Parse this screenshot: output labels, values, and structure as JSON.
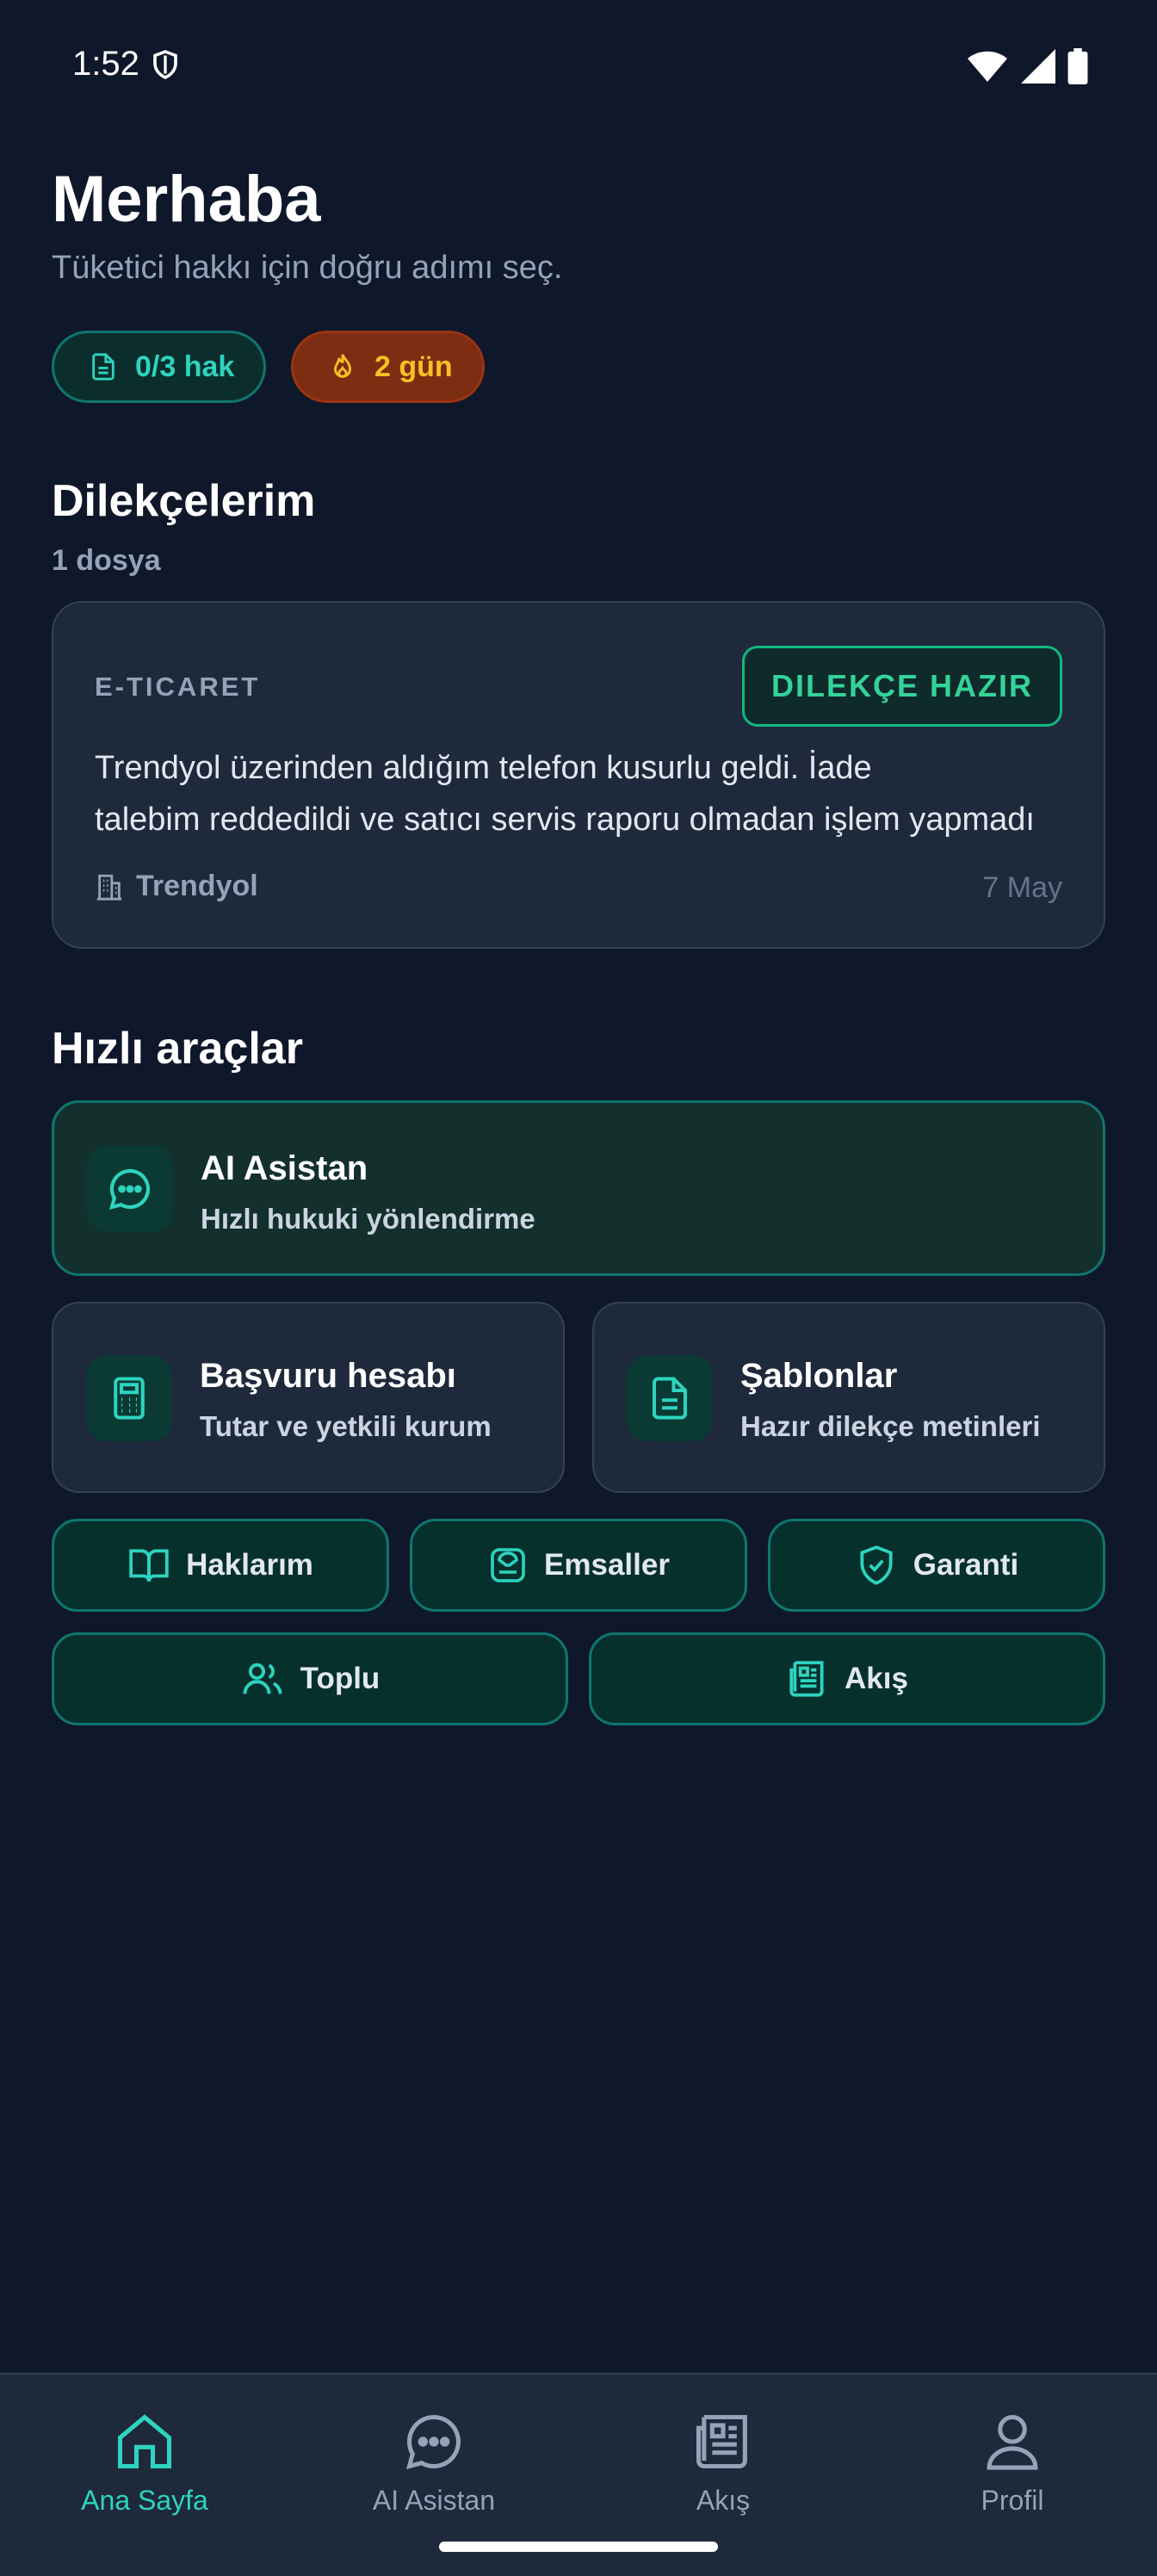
{
  "status_bar": {
    "time": "1:52"
  },
  "header": {
    "title": "Merhaba",
    "subtitle": "Tüketici hakkı için doğru adımı seç."
  },
  "chips": {
    "quota": "0/3 hak",
    "streak": "2 gün"
  },
  "petitions": {
    "title": "Dilekçelerim",
    "count": "1 dosya",
    "items": [
      {
        "category": "E-TICARET",
        "status": "DILEKÇE HAZIR",
        "description_line1": "Trendyol üzerinden aldığım telefon kusurlu geldi. İade",
        "description_line2": "talebim reddedildi ve satıcı servis raporu olmadan işlem yapmadı",
        "company": "Trendyol",
        "date": "7 May"
      }
    ]
  },
  "quick_tools": {
    "title": "Hızlı araçlar",
    "ai": {
      "title": "AI Asistan",
      "subtitle": "Hızlı hukuki yönlendirme"
    },
    "calc": {
      "title": "Başvuru hesabı",
      "subtitle": "Tutar ve yetkili kurum"
    },
    "templates": {
      "title": "Şablonlar",
      "subtitle": "Hazır dilekçe metinleri"
    },
    "pills": {
      "rights": "Haklarım",
      "precedents": "Emsaller",
      "warranty": "Garanti",
      "collective": "Toplu",
      "feed": "Akış"
    }
  },
  "bottom_nav": {
    "home": "Ana Sayfa",
    "assistant": "AI Asistan",
    "feed": "Akış",
    "profile": "Profil"
  },
  "colors": {
    "background": "#0f172a",
    "card": "#1e293b",
    "accent": "#2dd4bf",
    "success": "#10b981",
    "streak": "#fbbf24"
  }
}
